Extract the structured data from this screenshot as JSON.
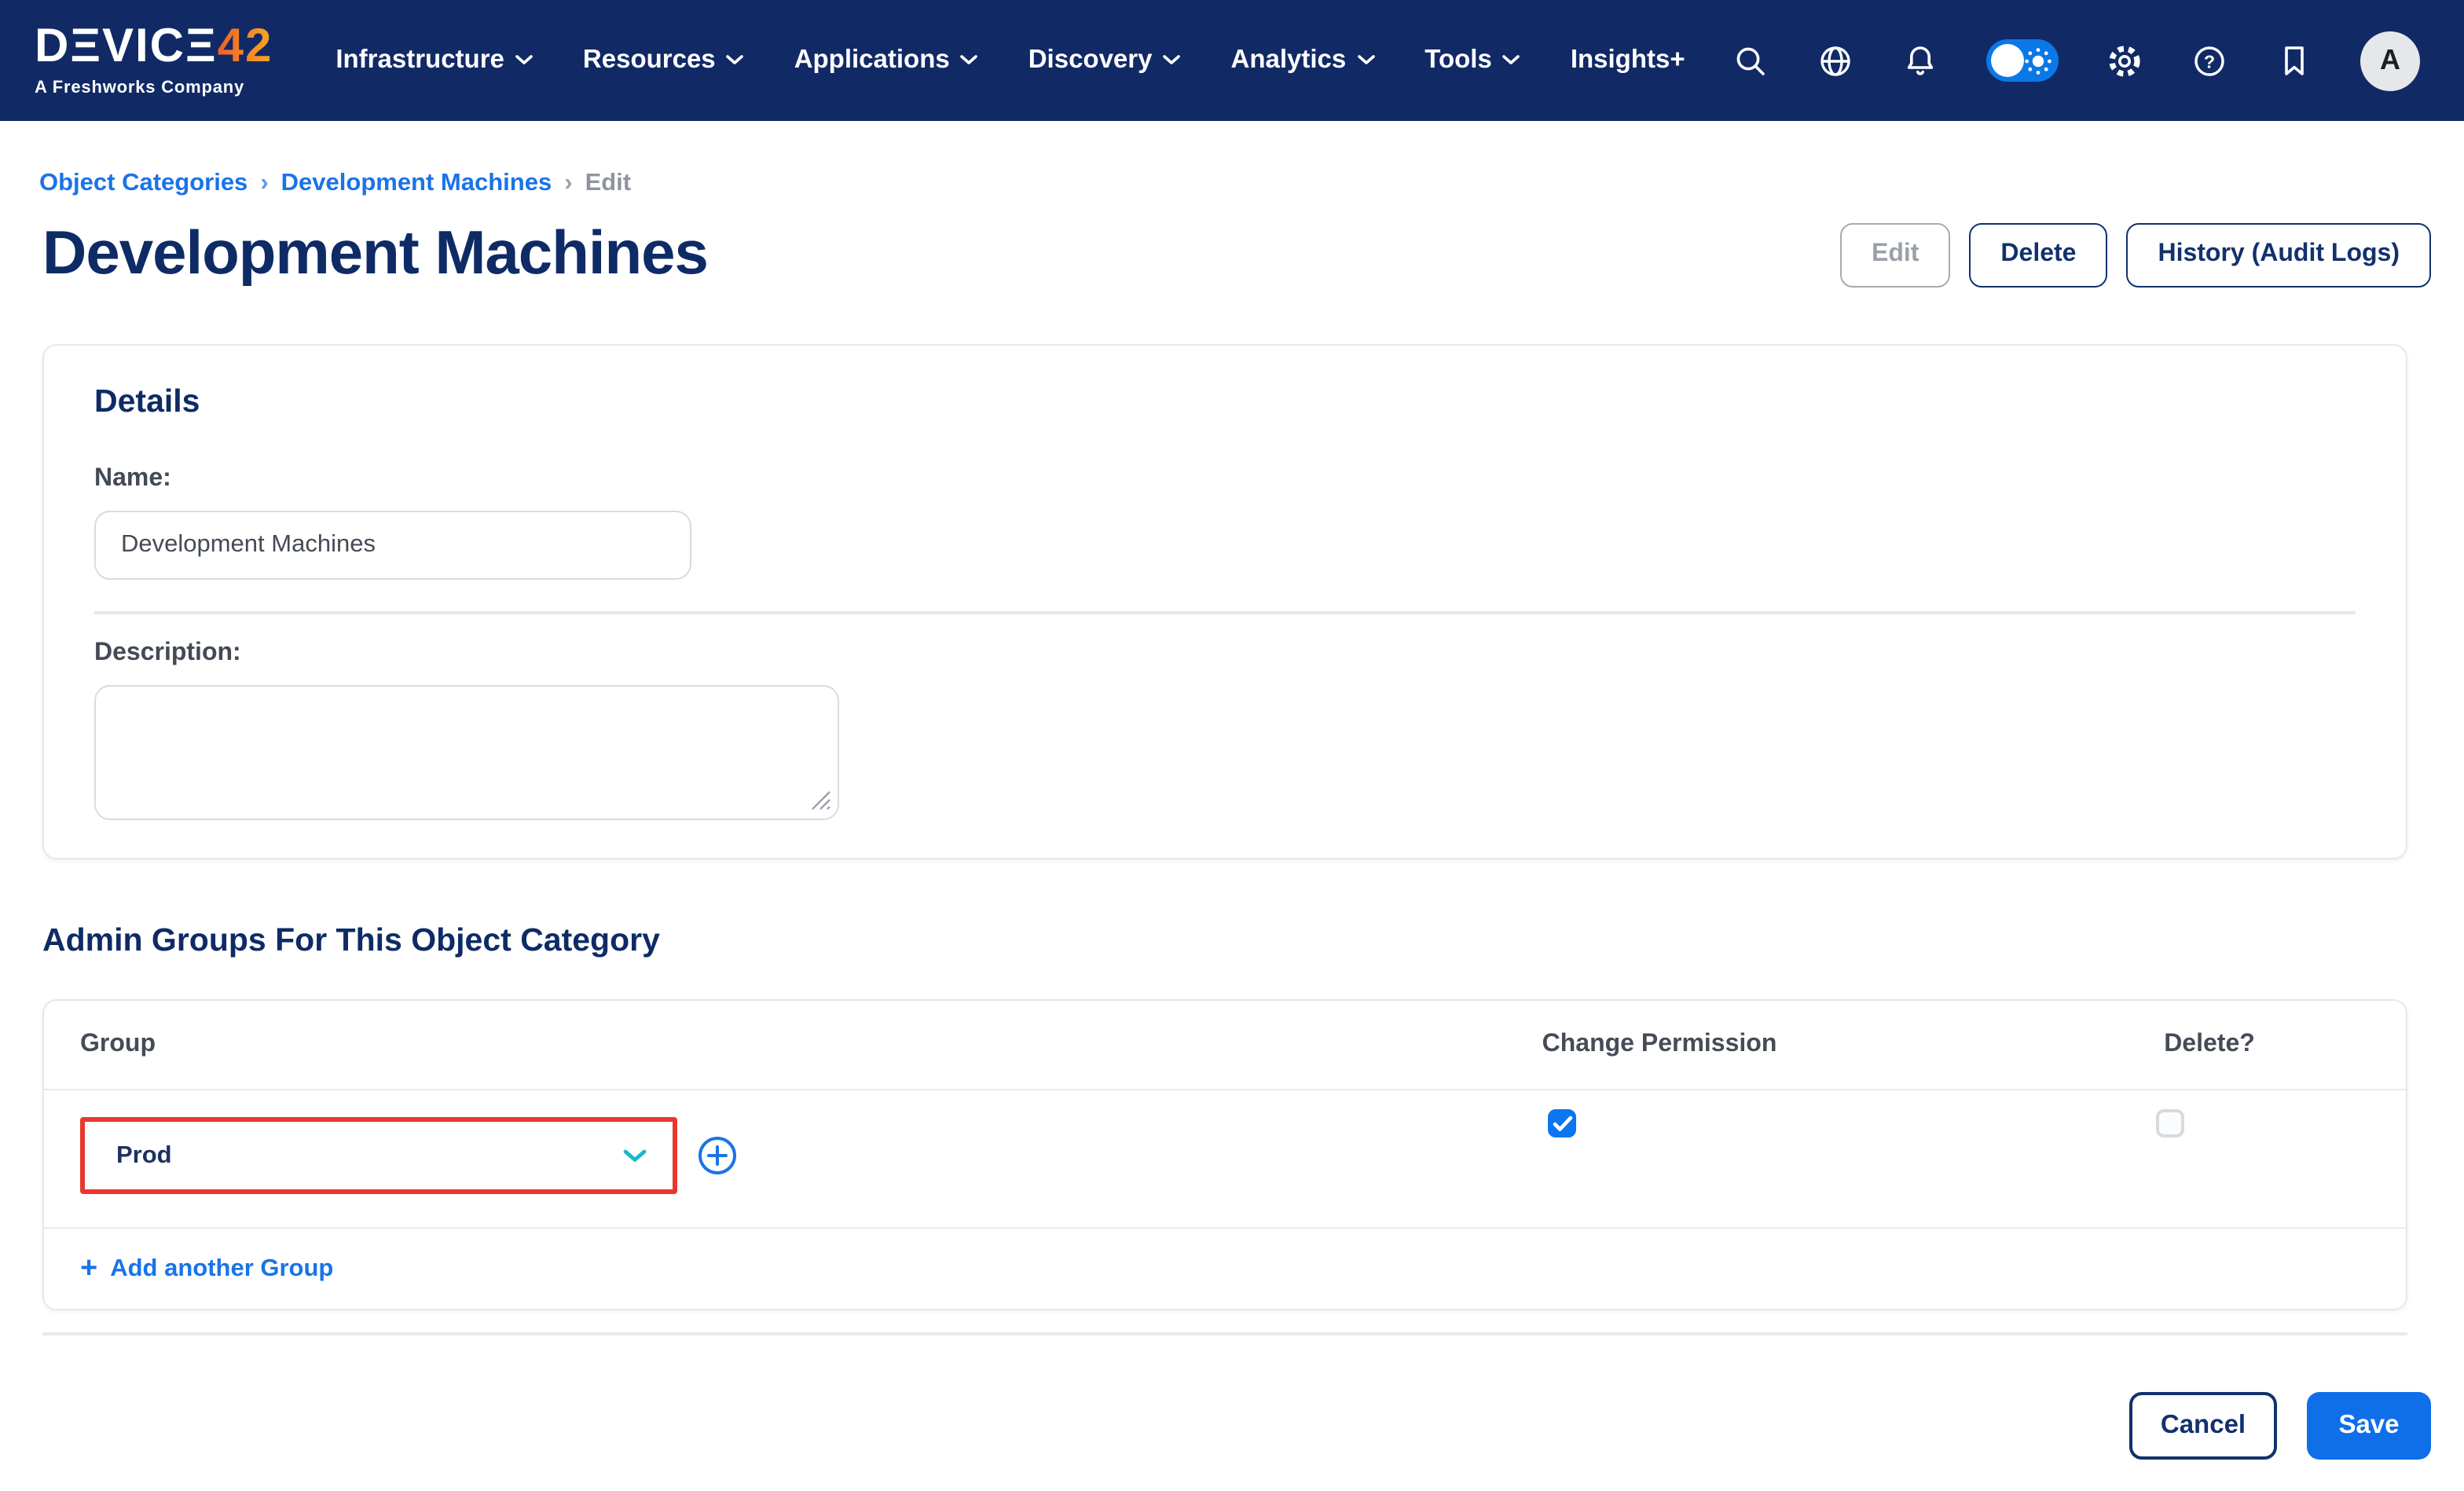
{
  "nav": {
    "logo": {
      "display_main": "DΞVICΞ",
      "display_4": "4",
      "display_2": "2",
      "brand": "DEVICE42",
      "subtitle": "A Freshworks Company"
    },
    "items": [
      {
        "label": "Infrastructure",
        "dropdown": true
      },
      {
        "label": "Resources",
        "dropdown": true
      },
      {
        "label": "Applications",
        "dropdown": true
      },
      {
        "label": "Discovery",
        "dropdown": true
      },
      {
        "label": "Analytics",
        "dropdown": true
      },
      {
        "label": "Tools",
        "dropdown": true
      },
      {
        "label": "Insights+",
        "dropdown": false
      }
    ],
    "icon_names": [
      "search-icon",
      "globe-icon",
      "bell-icon",
      "theme-toggle",
      "gear-icon",
      "help-icon",
      "bookmark-icon"
    ],
    "avatar_letter": "A"
  },
  "breadcrumb": {
    "links": [
      "Object Categories",
      "Development Machines"
    ],
    "separator": "›",
    "current": "Edit"
  },
  "page": {
    "title": "Development Machines"
  },
  "header_actions": {
    "edit": "Edit",
    "delete": "Delete",
    "history": "History (Audit Logs)"
  },
  "details": {
    "heading": "Details",
    "name_label": "Name:",
    "name_value": "Development Machines",
    "description_label": "Description:",
    "description_value": ""
  },
  "admin_groups": {
    "heading": "Admin Groups For This Object Category",
    "columns": {
      "group": "Group",
      "change_permission": "Change Permission",
      "delete": "Delete?"
    },
    "row": {
      "group_value": "Prod",
      "change_permission_checked": true,
      "delete_checked": false
    },
    "add_icon": "+",
    "add_label": "Add another Group"
  },
  "footer": {
    "cancel": "Cancel",
    "save": "Save"
  },
  "colors": {
    "navbar": "#112a66",
    "navy_text": "#0e2b66",
    "link_blue": "#1a73e8",
    "save_blue": "#0e6fe9",
    "checkbox_blue": "#0b76f0",
    "toggle_blue": "#0b78e8",
    "highlight_red": "#e8382d",
    "select_chevron_teal": "#17b9c9",
    "logo_orange_start": "#ee5f28",
    "logo_orange_end": "#f9a823"
  }
}
